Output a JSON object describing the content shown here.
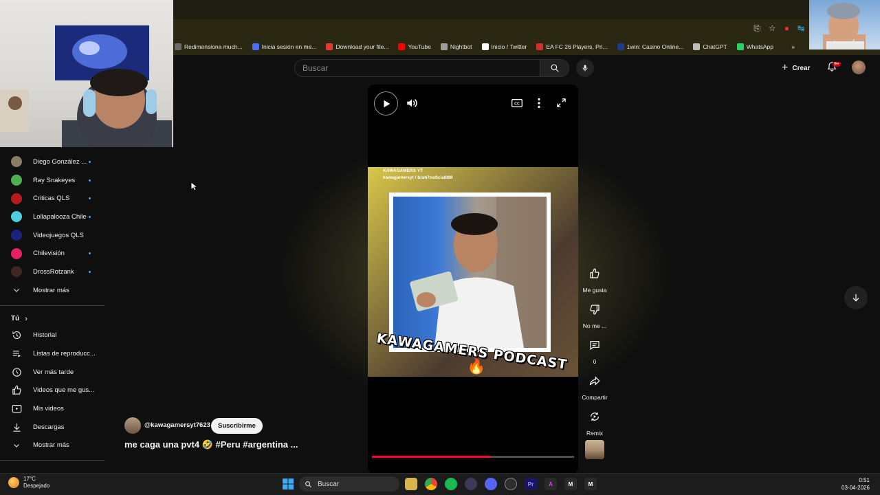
{
  "browser": {
    "bookmarks": [
      {
        "label": "Redimensiona much...",
        "color": "#6b6b6b"
      },
      {
        "label": "Inicia sesión en me...",
        "color": "#4a6cf7"
      },
      {
        "label": "Download your file...",
        "color": "#e53935"
      },
      {
        "label": "YouTube",
        "color": "#ff0000"
      },
      {
        "label": "Nightbot",
        "color": "#9e9e9e"
      },
      {
        "label": "Inicio / Twitter",
        "color": "#ffffff"
      },
      {
        "label": "EA FC 26 Players, Pri...",
        "color": "#d32f2f"
      },
      {
        "label": "1win: Casino Online...",
        "color": "#1e3a8a"
      },
      {
        "label": "ChatGPT",
        "color": "#bdbdbd"
      },
      {
        "label": "WhatsApp",
        "color": "#25d366"
      }
    ],
    "more_bookmarks": "»"
  },
  "header": {
    "search_placeholder": "Buscar",
    "create_label": "Crear",
    "notif_badge": "9+"
  },
  "sidebar": {
    "subscriptions": [
      {
        "label": "Diego González ...",
        "color": "#8a7d66",
        "dot": true
      },
      {
        "label": "Ray Snakeyes",
        "color": "#4caf50",
        "dot": true
      },
      {
        "label": "Criticas QLS",
        "color": "#b71c1c",
        "dot": true
      },
      {
        "label": "Lollapalooza Chile",
        "color": "#4dd0e1",
        "dot": true
      },
      {
        "label": "Videojuegos QLS",
        "color": "#1a237e",
        "dot": false
      },
      {
        "label": "Chilevisión",
        "color": "#e91e63",
        "dot": true
      },
      {
        "label": "DrossRotzank",
        "color": "#3e2723",
        "dot": true
      }
    ],
    "show_more_1": "Mostrar más",
    "you_title": "Tú",
    "you_items": [
      {
        "label": "Historial",
        "icon": "history-icon"
      },
      {
        "label": "Listas de reproducc...",
        "icon": "playlist-icon"
      },
      {
        "label": "Ver más tarde",
        "icon": "watch-later-icon"
      },
      {
        "label": "Videos que me gus...",
        "icon": "like-icon"
      },
      {
        "label": "Mis videos",
        "icon": "my-videos-icon"
      },
      {
        "label": "Descargas",
        "icon": "download-icon"
      }
    ],
    "show_more_2": "Mostrar más"
  },
  "video": {
    "overlay_line1": "KAWAGAMERS YT",
    "overlay_line2": "kawagamersyt / brah7noficial898",
    "podcast_title": "KAWAGAMERS  PODCAST",
    "progress": 0.59
  },
  "actions": {
    "like_label": "Me gusta",
    "dislike_label": "No me ...",
    "comments_count": "0",
    "share_label": "Compartir",
    "remix_label": "Remix"
  },
  "channel": {
    "handle": "@kawagamersyt7623",
    "subscribe_label": "Suscribirme",
    "title": "me caga una pvt4 🤣 #Peru #argentina ..."
  },
  "taskbar": {
    "temperature": "17°C",
    "weather": "Despejado",
    "search_label": "Buscar",
    "time": "0:51",
    "date": "03-04-2026"
  }
}
